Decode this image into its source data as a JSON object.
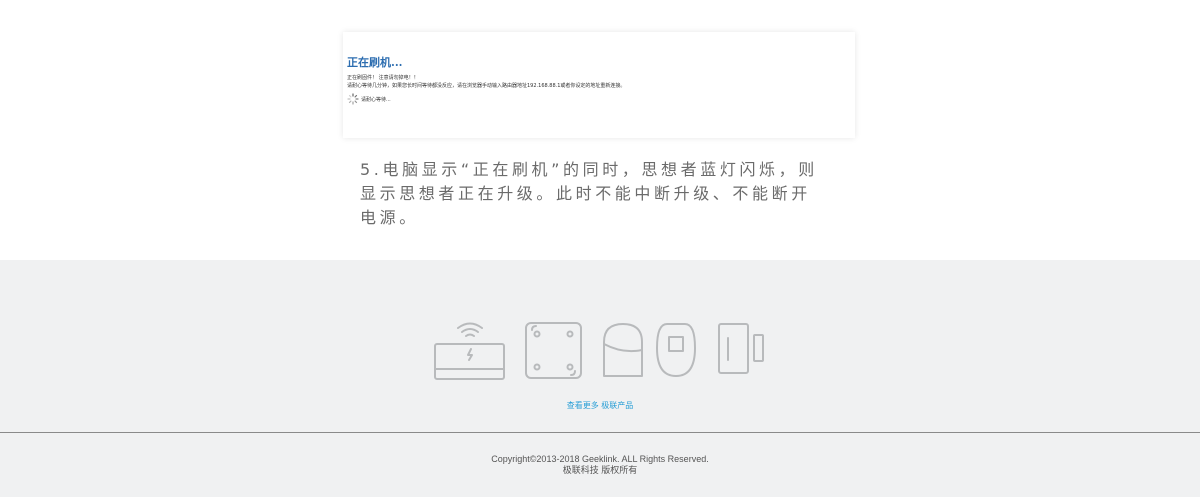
{
  "flash_screenshot": {
    "title": "正在刷机...",
    "line1": "正在刷固件！ 注意请勿掉电！！",
    "line2": "请耐心等待几分钟，如果您长时间等待都没反应，请在浏览器手动输入路由器地址192.168.88.1或者你设定的地址重新连接。",
    "waiting": "请耐心等待..."
  },
  "caption": "5.电脑显示“正在刷机”的同时，思想者蓝灯闪烁，则显示思想者正在升级。此时不能中断升级、不能断开电源。",
  "products": {
    "icons": [
      "wifi-router-icon",
      "scene-panel-icon",
      "smart-plug-icon",
      "sensor-icon",
      "door-sensor-icon"
    ],
    "more_link": "查看更多 极联产品"
  },
  "footer": {
    "copyright": "Copyright©2013-2018 Geeklink. ALL Rights Reserved.",
    "company": "极联科技 版权所有"
  },
  "colors": {
    "accent": "#2a9fd6",
    "title_blue": "#2c6db0",
    "footer_bg": "#f0f1f2",
    "icon_stroke": "#b8babc"
  }
}
